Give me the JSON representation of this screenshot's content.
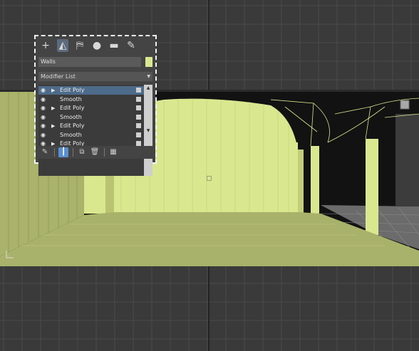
{
  "command_panel": {
    "tabs": [
      {
        "name": "create-tab",
        "glyph": "+"
      },
      {
        "name": "modify-tab",
        "glyph": "◭"
      },
      {
        "name": "hierarchy-tab",
        "glyph": "⛿"
      },
      {
        "name": "motion-tab",
        "glyph": "●"
      },
      {
        "name": "display-tab",
        "glyph": "▬"
      },
      {
        "name": "utilities-tab",
        "glyph": "✎"
      }
    ],
    "object_name": "Walls",
    "object_color": "#d9e88f",
    "modifier_list_label": "Modifier List",
    "stack": [
      {
        "label": "Edit Poly",
        "has_arrow": true,
        "selected": true
      },
      {
        "label": "Smooth",
        "has_arrow": false,
        "selected": false
      },
      {
        "label": "Edit Poly",
        "has_arrow": true,
        "selected": false
      },
      {
        "label": "Smooth",
        "has_arrow": false,
        "selected": false
      },
      {
        "label": "Edit Poly",
        "has_arrow": true,
        "selected": false
      },
      {
        "label": "Smooth",
        "has_arrow": false,
        "selected": false
      },
      {
        "label": "Edit Poly",
        "has_arrow": true,
        "selected": false
      }
    ]
  },
  "scene": {
    "wall_color": "#d9e88f",
    "floor_color": "#a9b26a",
    "grid_color": "#4b4b4b",
    "background": "#3a3a3a"
  }
}
